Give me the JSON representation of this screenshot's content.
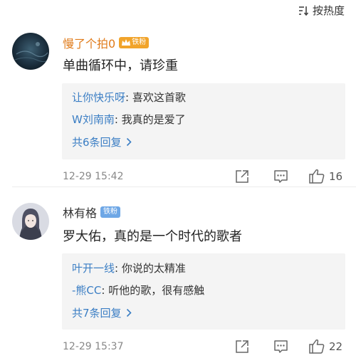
{
  "sort": {
    "label": "按热度"
  },
  "comments": [
    {
      "username": "慢了个拍0",
      "username_color": "#e07b1a",
      "badge": "铁粉",
      "badge_color": "#f1a42b",
      "text": "单曲循环中，请珍重",
      "replies": [
        {
          "name": "让你快乐呀",
          "text": ": 喜欢这首歌"
        },
        {
          "name": "W刘南南",
          "text": ": 我真的是爱了"
        }
      ],
      "more_label": "共6条回复",
      "time": "12-29 15:42",
      "likes": "16"
    },
    {
      "username": "林有格",
      "username_color": "#333333",
      "badge": "铁粉",
      "badge_color": "#6ea7e6",
      "text": "罗大佑，真的是一个时代的歌者",
      "replies": [
        {
          "name": "叶开一线",
          "text": ": 你说的太精准"
        },
        {
          "name": "-熊CC",
          "text": ": 听他的歌，很有感触"
        }
      ],
      "more_label": "共7条回复",
      "time": "12-29 15:37",
      "likes": "22"
    }
  ]
}
